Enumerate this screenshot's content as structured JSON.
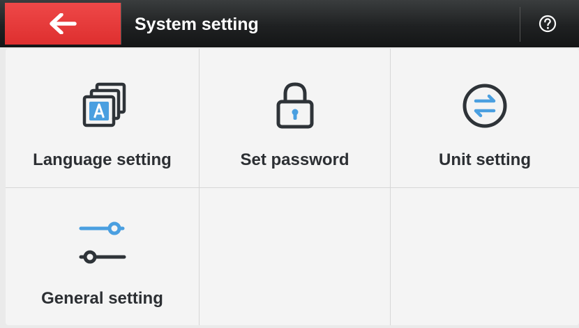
{
  "header": {
    "title": "System setting",
    "back_icon": "arrow-left-icon",
    "help_icon": "question-circle-icon"
  },
  "colors": {
    "accent_red": "#e63b3b",
    "header_dark": "#1f2122",
    "icon_dark": "#2e3338",
    "icon_blue": "#4a9fe0"
  },
  "menu": {
    "items": [
      {
        "label": "Language setting",
        "icon": "language-icon"
      },
      {
        "label": "Set password",
        "icon": "lock-icon"
      },
      {
        "label": "Unit setting",
        "icon": "unit-swap-icon"
      },
      {
        "label": "General setting",
        "icon": "sliders-icon"
      }
    ]
  }
}
